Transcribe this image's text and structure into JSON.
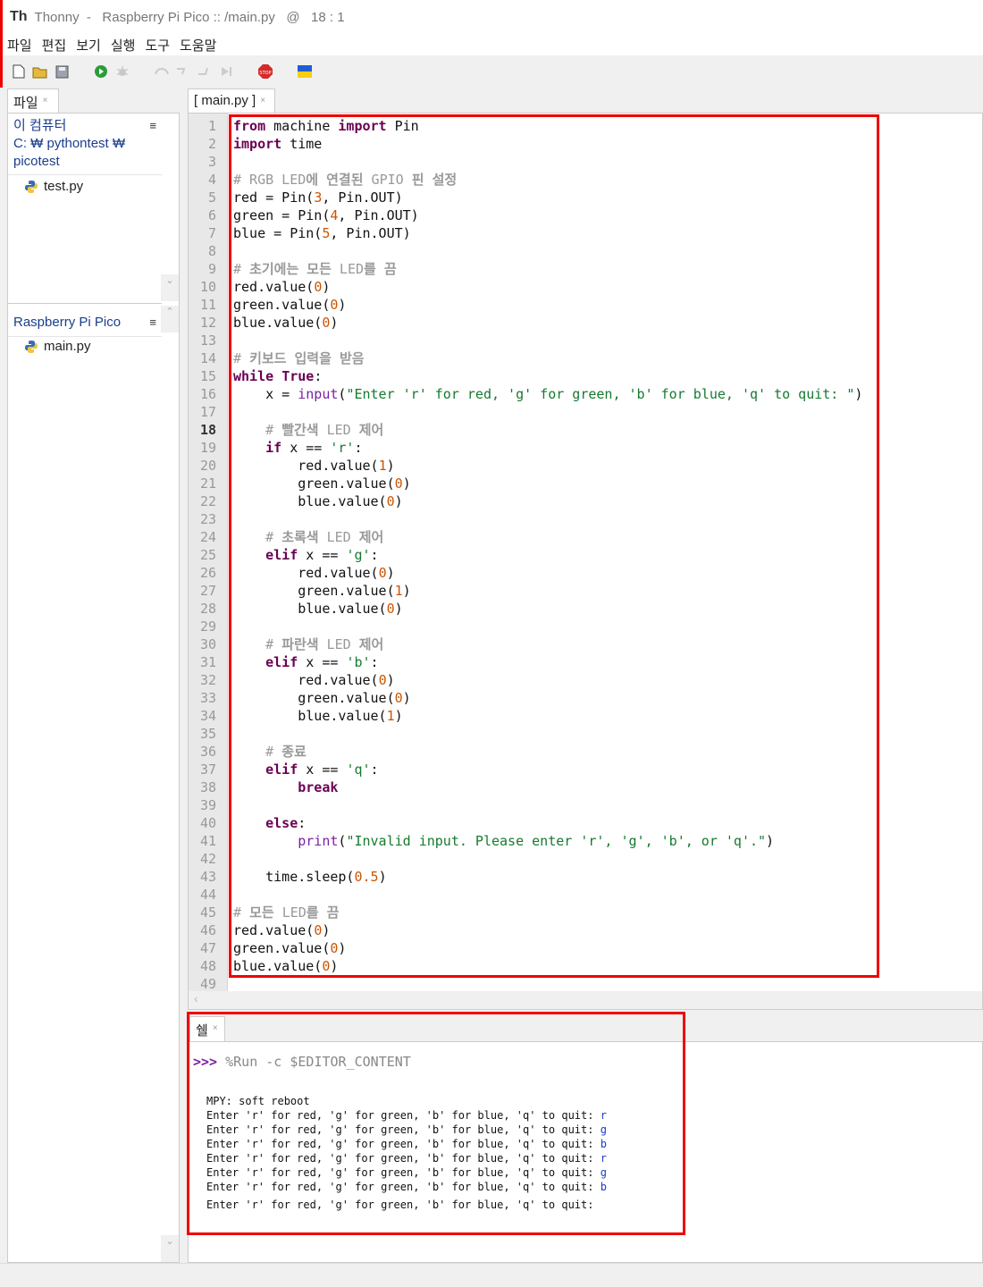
{
  "window": {
    "app_name": "Thonny",
    "title": "  -   Raspberry Pi Pico :: /main.py   @   18 : 1"
  },
  "menu": [
    "파일",
    "편집",
    "보기",
    "실행",
    "도구",
    "도움말"
  ],
  "files_tab": {
    "label": "파일",
    "close": "×"
  },
  "files": {
    "computer": {
      "heading_line1": "이 컴퓨터",
      "heading_line2": "C: ₩ pythontest ₩",
      "heading_line3": "picotest",
      "items": [
        "test.py"
      ]
    },
    "device": {
      "heading": "Raspberry Pi Pico",
      "items": [
        "main.py"
      ]
    },
    "menu_glyph": "≡"
  },
  "editor_tab": {
    "label": "[ main.py ]",
    "close": "×"
  },
  "editor": {
    "current_line": 18,
    "line_numbers": [
      "1",
      "2",
      "3",
      "4",
      "5",
      "6",
      "7",
      "8",
      "9",
      "10",
      "11",
      "12",
      "13",
      "14",
      "15",
      "16",
      "17",
      "18",
      "19",
      "20",
      "21",
      "22",
      "23",
      "24",
      "25",
      "26",
      "27",
      "28",
      "29",
      "30",
      "31",
      "32",
      "33",
      "34",
      "35",
      "36",
      "37",
      "38",
      "39",
      "40",
      "41",
      "42",
      "43",
      "44",
      "45",
      "46",
      "47",
      "48",
      "49"
    ],
    "code": [
      "from machine import Pin",
      "import time",
      "",
      "# RGB LED에 연결된 GPIO 핀 설정",
      "red = Pin(3, Pin.OUT)",
      "green = Pin(4, Pin.OUT)",
      "blue = Pin(5, Pin.OUT)",
      "",
      "# 초기에는 모든 LED를 끔",
      "red.value(0)",
      "green.value(0)",
      "blue.value(0)",
      "",
      "# 키보드 입력을 받음",
      "while True:",
      "    x = input(\"Enter 'r' for red, 'g' for green, 'b' for blue, 'q' to quit: \")",
      "",
      "    # 빨간색 LED 제어",
      "    if x == 'r':",
      "        red.value(1)",
      "        green.value(0)",
      "        blue.value(0)",
      "",
      "    # 초록색 LED 제어",
      "    elif x == 'g':",
      "        red.value(0)",
      "        green.value(1)",
      "        blue.value(0)",
      "",
      "    # 파란색 LED 제어",
      "    elif x == 'b':",
      "        red.value(0)",
      "        green.value(0)",
      "        blue.value(1)",
      "",
      "    # 종료",
      "    elif x == 'q':",
      "        break",
      "",
      "    else:",
      "        print(\"Invalid input. Please enter 'r', 'g', 'b', or 'q'.\")",
      "",
      "    time.sleep(0.5)",
      "",
      "# 모든 LED를 끔",
      "red.value(0)",
      "green.value(0)",
      "blue.value(0)"
    ]
  },
  "shell_tab": {
    "label": "쉘",
    "close": "×"
  },
  "shell": {
    "prompt": ">>>",
    "command": " %Run -c $EDITOR_CONTENT",
    "reboot": "MPY: soft reboot",
    "prompt_text": "Enter 'r' for red, 'g' for green, 'b' for blue, 'q' to quit: ",
    "inputs": [
      "r",
      "g",
      "b",
      "r",
      "g",
      "b"
    ],
    "last_line": "Enter 'r' for red, 'g' for green, 'b' for blue, 'q' to quit:"
  },
  "colors": {
    "highlight_border": "#e00000",
    "keyword": "#6a0052",
    "number": "#cc5500",
    "string": "#157a2e",
    "comment": "#999999",
    "shell_input": "#1a3ec8"
  }
}
